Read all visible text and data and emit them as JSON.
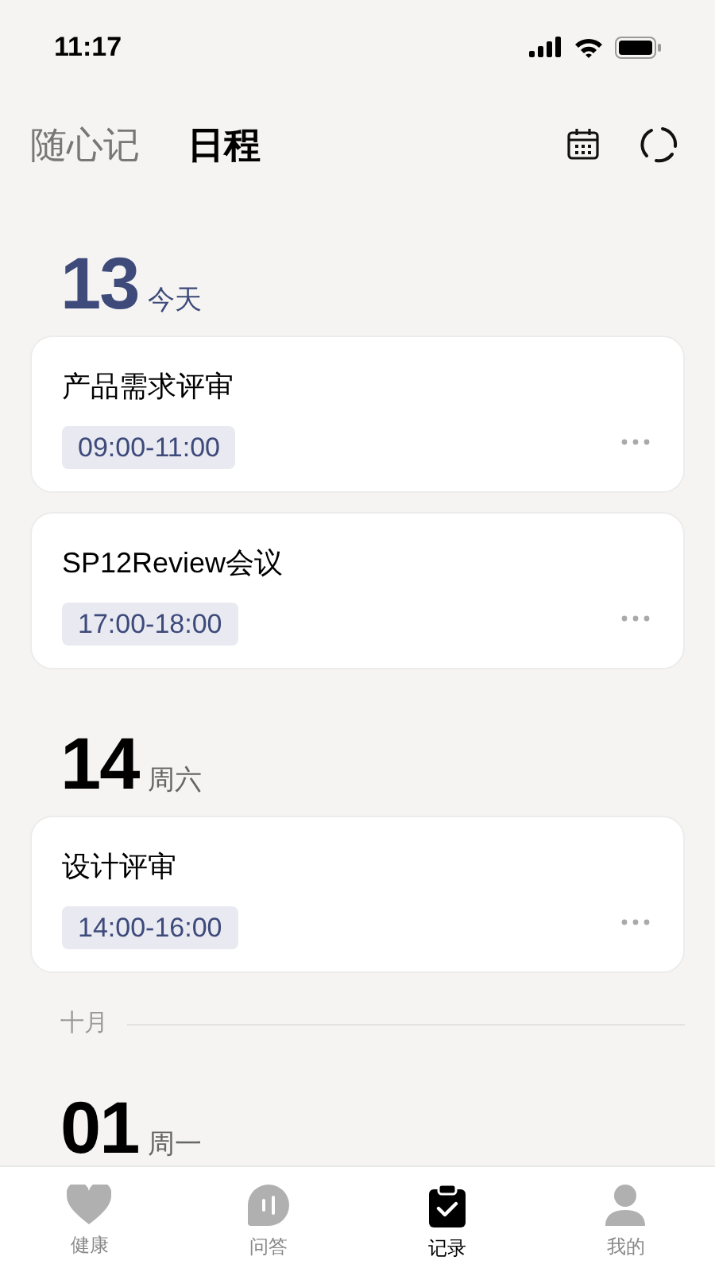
{
  "status_bar": {
    "time": "11:17"
  },
  "header": {
    "tabs": [
      {
        "label": "随心记",
        "selected": false
      },
      {
        "label": "日程",
        "selected": true
      }
    ]
  },
  "schedule": [
    {
      "kind": "day",
      "date": "13",
      "weekday": "今天",
      "today": true,
      "events": [
        {
          "title": "产品需求评审",
          "time": "09:00-11:00"
        },
        {
          "title": "SP12Review会议",
          "time": "17:00-18:00"
        }
      ]
    },
    {
      "kind": "day",
      "date": "14",
      "weekday": "周六",
      "today": false,
      "events": [
        {
          "title": "设计评审",
          "time": "14:00-16:00"
        }
      ]
    },
    {
      "kind": "month",
      "label": "十月"
    },
    {
      "kind": "day",
      "date": "01",
      "weekday": "周一",
      "today": false
    }
  ],
  "bottom_nav": [
    {
      "label": "健康",
      "kind": "heart",
      "selected": false
    },
    {
      "label": "问答",
      "kind": "voice",
      "selected": false
    },
    {
      "label": "记录",
      "kind": "clipboard",
      "selected": true
    },
    {
      "label": "我的",
      "kind": "person",
      "selected": false
    }
  ]
}
